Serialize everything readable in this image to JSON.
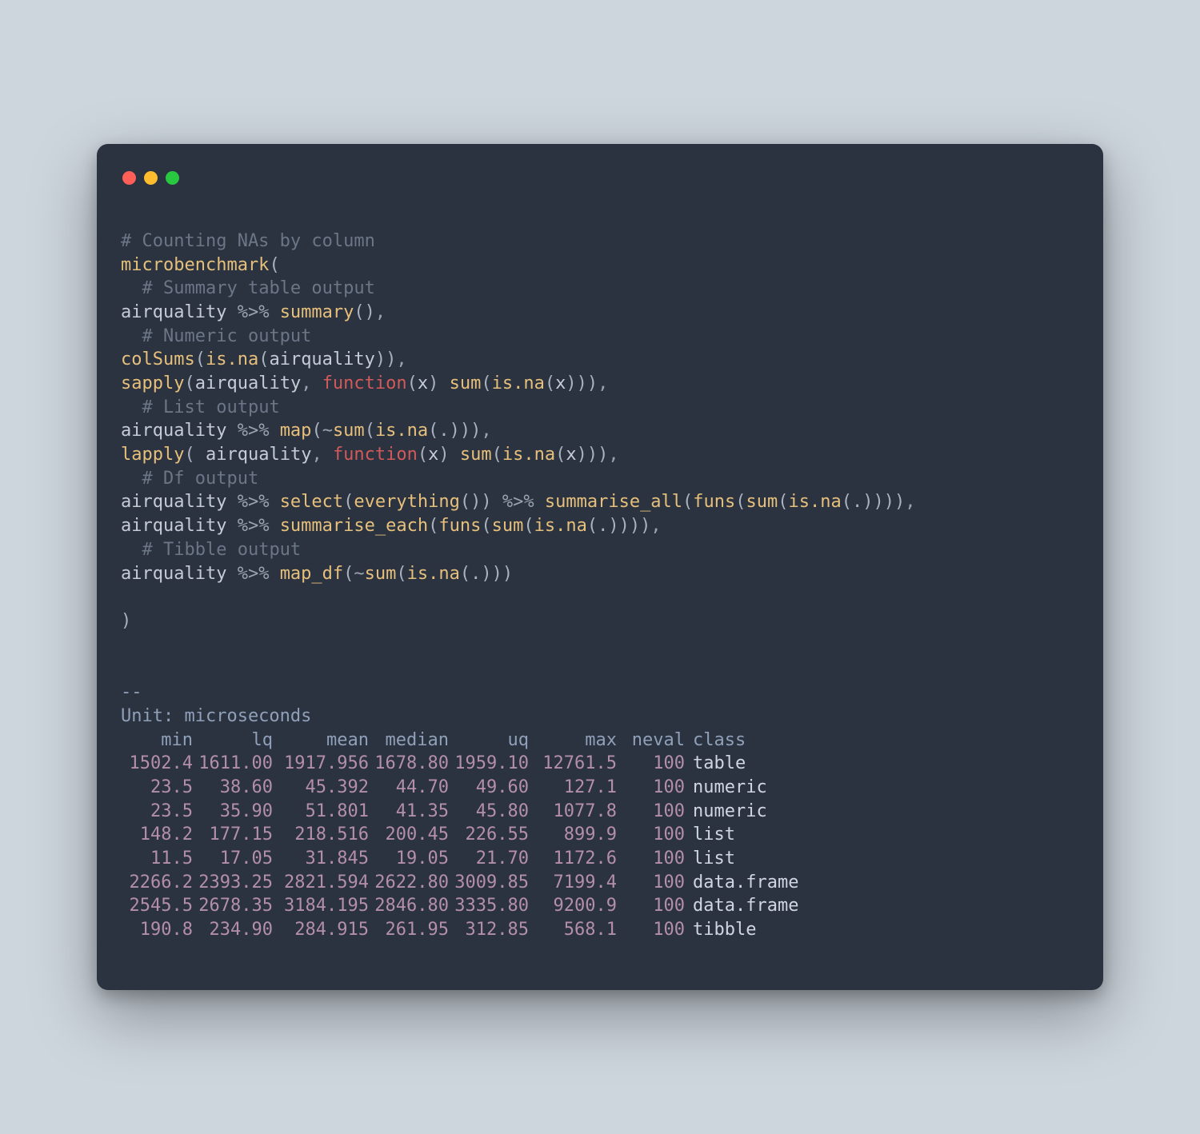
{
  "code": {
    "l1": "# Counting NAs by column",
    "mb": "microbenchmark",
    "c2": "# Summary table output",
    "aq": "airquality",
    "pipe": " %>% ",
    "summary": "summary",
    "c3": "# Numeric output",
    "colsums": "colSums",
    "isna": "is.na",
    "sapply": "sapply",
    "function": "function",
    "sum": "sum",
    "x": "x",
    "c4": "# List output",
    "map": "map",
    "tilde": "~",
    "dot": ".",
    "lapply": "lapply",
    "c5": "# Df output",
    "select": "select",
    "everything": "everything",
    "summarise_all": "summarise_all",
    "funs": "funs",
    "summarise_each": "summarise_each",
    "c6": "# Tibble output",
    "map_df": "map_df",
    "open": "(",
    "close": ")",
    "comma": ", ",
    "commaTrail": ",",
    "sep": "--",
    "space": " "
  },
  "output": {
    "unit": "Unit: microseconds",
    "headers": [
      "min",
      "lq",
      "mean",
      "median",
      "uq",
      "max",
      "neval",
      "class"
    ],
    "rows": [
      {
        "min": "1502.4",
        "lq": "1611.00",
        "mean": "1917.956",
        "median": "1678.80",
        "uq": "1959.10",
        "max": "12761.5",
        "neval": "100",
        "class": "table"
      },
      {
        "min": "23.5",
        "lq": "38.60",
        "mean": "45.392",
        "median": "44.70",
        "uq": "49.60",
        "max": "127.1",
        "neval": "100",
        "class": "numeric"
      },
      {
        "min": "23.5",
        "lq": "35.90",
        "mean": "51.801",
        "median": "41.35",
        "uq": "45.80",
        "max": "1077.8",
        "neval": "100",
        "class": "numeric"
      },
      {
        "min": "148.2",
        "lq": "177.15",
        "mean": "218.516",
        "median": "200.45",
        "uq": "226.55",
        "max": "899.9",
        "neval": "100",
        "class": "list"
      },
      {
        "min": "11.5",
        "lq": "17.05",
        "mean": "31.845",
        "median": "19.05",
        "uq": "21.70",
        "max": "1172.6",
        "neval": "100",
        "class": "list"
      },
      {
        "min": "2266.2",
        "lq": "2393.25",
        "mean": "2821.594",
        "median": "2622.80",
        "uq": "3009.85",
        "max": "7199.4",
        "neval": "100",
        "class": "data.frame"
      },
      {
        "min": "2545.5",
        "lq": "2678.35",
        "mean": "3184.195",
        "median": "2846.80",
        "uq": "3335.80",
        "max": "9200.9",
        "neval": "100",
        "class": "data.frame"
      },
      {
        "min": "190.8",
        "lq": "234.90",
        "mean": "284.915",
        "median": "261.95",
        "uq": "312.85",
        "max": "568.1",
        "neval": "100",
        "class": "tibble"
      }
    ]
  }
}
